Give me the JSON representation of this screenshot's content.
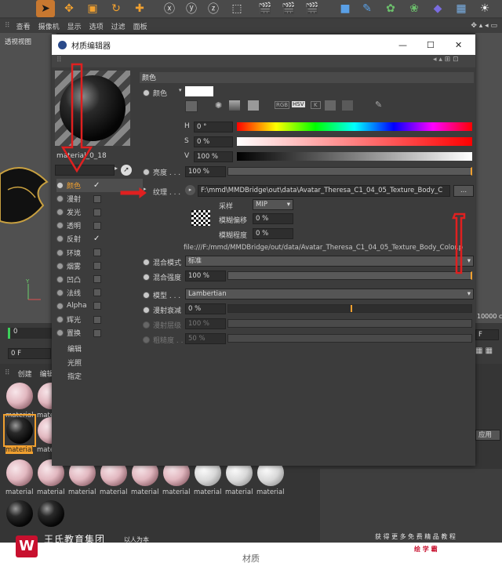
{
  "menubar": {
    "items": [
      "查看",
      "摄像机",
      "显示",
      "选项",
      "过滤",
      "面板"
    ]
  },
  "viewport": {
    "label": "透视视图",
    "distance": "10000 c"
  },
  "window": {
    "title": "材质编辑器",
    "min": "—",
    "max": "☐",
    "close": "✕"
  },
  "material": {
    "name": "material_0_18"
  },
  "channels": [
    {
      "label": "颜色",
      "checked": true,
      "active": true
    },
    {
      "label": "漫射",
      "checked": false
    },
    {
      "label": "发光",
      "checked": false
    },
    {
      "label": "透明",
      "checked": false
    },
    {
      "label": "反射",
      "checked": true
    },
    {
      "label": "环境",
      "checked": false
    },
    {
      "label": "烟雾",
      "checked": false
    },
    {
      "label": "凹凸",
      "checked": false
    },
    {
      "label": "法线",
      "checked": false
    },
    {
      "label": "Alpha",
      "checked": false
    },
    {
      "label": "辉光",
      "checked": false
    },
    {
      "label": "置换",
      "checked": false
    }
  ],
  "extra_channels": [
    "编辑",
    "光照",
    "指定"
  ],
  "color_panel": {
    "section": "颜色",
    "color_label": "颜色",
    "modes": [
      "RGB",
      "HSV",
      "K"
    ],
    "h_label": "H",
    "h_value": "0 °",
    "s_label": "S",
    "s_value": "0 %",
    "v_label": "V",
    "v_value": "100 %",
    "brightness_label": "亮度 . . .",
    "brightness_value": "100 %",
    "texture_label": "纹理 . . .",
    "texture_path": "F:\\mmd\\MMDBridge\\out\\data\\Avatar_Theresa_C1_04_05_Texture_Body_C",
    "texture_btn": "...",
    "sampling_label": "采样",
    "sampling_value": "MIP",
    "blur_offset_label": "模糊偏移",
    "blur_offset_value": "0 %",
    "blur_scale_label": "模糊程度",
    "blur_scale_value": "0 %",
    "file_url": "file:///F:/mmd/MMDBridge/out/data/Avatar_Theresa_C1_04_05_Texture_Body_Color.p",
    "mix_mode_label": "混合模式",
    "mix_mode_value": "标准",
    "mix_strength_label": "混合强度",
    "mix_strength_value": "100 %",
    "model_label": "模型 . . .",
    "model_value": "Lambertian",
    "diffuse_falloff_label": "漫射衰减",
    "diffuse_falloff_value": "0 %",
    "diffuse_level_label": "漫射层级",
    "diffuse_level_value": "100 %",
    "roughness_label": "粗糙度 . .",
    "roughness_value": "50 %"
  },
  "timeline": {
    "frame0": "0",
    "frame_field": "0 F",
    "frame_right": "F"
  },
  "material_manager": {
    "tabs": [
      "创建",
      "编辑"
    ],
    "thumb_label": "material",
    "apply_btn": "应用"
  },
  "watermark": {
    "logo": "W",
    "company": "王氏教育集团",
    "slogan": "以人为本",
    "right_text": "获 得 更 多 免 费 精 品 教 程",
    "right_red": "绘 学 霸"
  },
  "caption": "材质",
  "colors": {
    "accent_orange": "#f0a030",
    "arrow_red": "#e02020",
    "logo_red": "#c8102e"
  }
}
